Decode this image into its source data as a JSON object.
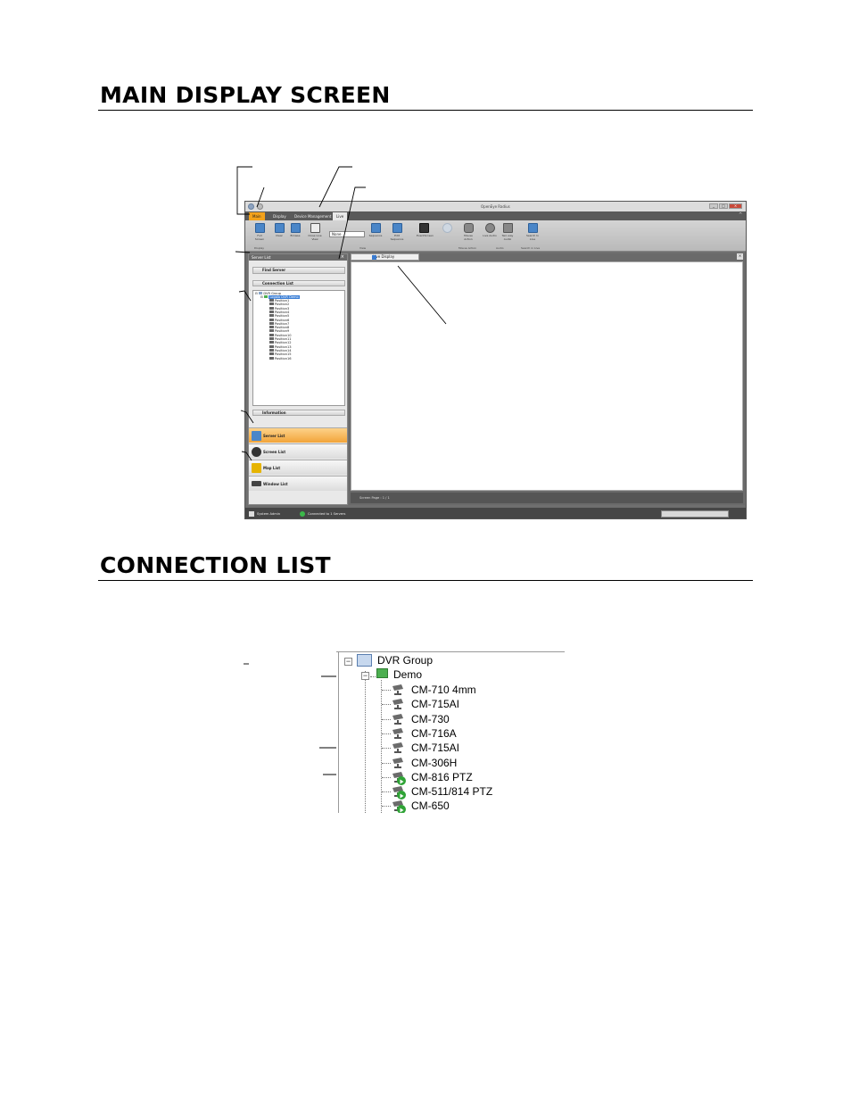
{
  "headings": {
    "main_display": "MAIN DISPLAY SCREEN",
    "connection_list": "CONNECTION LIST"
  },
  "app": {
    "window_title": "OpenEye Radius",
    "menu_tabs": [
      "Main",
      "Display",
      "Device Management",
      "Live"
    ],
    "ribbon": {
      "buttons": [
        {
          "label": "Full Screen",
          "icon": "grid-icon"
        },
        {
          "label": "Clear",
          "icon": "clear-icon"
        },
        {
          "label": "Browse",
          "icon": "layout-icon"
        },
        {
          "label": "Close Live View",
          "icon": "close-view-icon"
        },
        {
          "label": "Sequence",
          "icon": "sequence-icon"
        },
        {
          "label": "Edit Sequence",
          "icon": "edit-sequence-icon"
        },
        {
          "label": "EventScreen",
          "icon": "event-icon"
        },
        {
          "label": "",
          "icon": "zoom-icon"
        },
        {
          "label": "Mouse Action",
          "icon": "mouse-icon"
        },
        {
          "label": "Live Audio",
          "icon": "speaker-icon"
        },
        {
          "label": "Two way Audio",
          "icon": "microphone-icon"
        },
        {
          "label": "Search In Live",
          "icon": "search-live-icon"
        }
      ],
      "combo_value": "None",
      "group_labels": [
        "Display",
        "View",
        "Mouse Action",
        "Audio",
        "Search in Live"
      ]
    },
    "sidebar": {
      "panel_title": "Server List",
      "find_server": "Find Server",
      "connection_list": "Connection List",
      "tree_root": "DVR Group",
      "tree_server": "Logalo DVR Demo",
      "tree_items": [
        "Position1",
        "Position2",
        "Position3",
        "Position4",
        "Position5",
        "Position6",
        "Position7",
        "Position8",
        "Position9",
        "Position10",
        "Position11",
        "Position12",
        "Position13",
        "Position14",
        "Position15",
        "Position16"
      ],
      "information": "Information",
      "nav": [
        "Server List",
        "Screen List",
        "Map List",
        "Window List"
      ]
    },
    "center": {
      "tab_label": "Live Display",
      "screen_page": "Screen Page : 1 / 1"
    },
    "status": {
      "user": "System Admin",
      "connection": "Connected to 1 Servers"
    }
  },
  "connection_list": {
    "root": "DVR Group",
    "server": "Demo",
    "cameras": [
      {
        "name": "CM-710 4mm",
        "ptz": false
      },
      {
        "name": "CM-715AI",
        "ptz": false
      },
      {
        "name": "CM-730",
        "ptz": false
      },
      {
        "name": "CM-716A",
        "ptz": false
      },
      {
        "name": "CM-715AI",
        "ptz": false
      },
      {
        "name": "CM-306H",
        "ptz": false
      },
      {
        "name": "CM-816 PTZ",
        "ptz": true
      },
      {
        "name": "CM-511/814 PTZ",
        "ptz": true
      },
      {
        "name": "CM-650",
        "ptz": true
      }
    ]
  }
}
